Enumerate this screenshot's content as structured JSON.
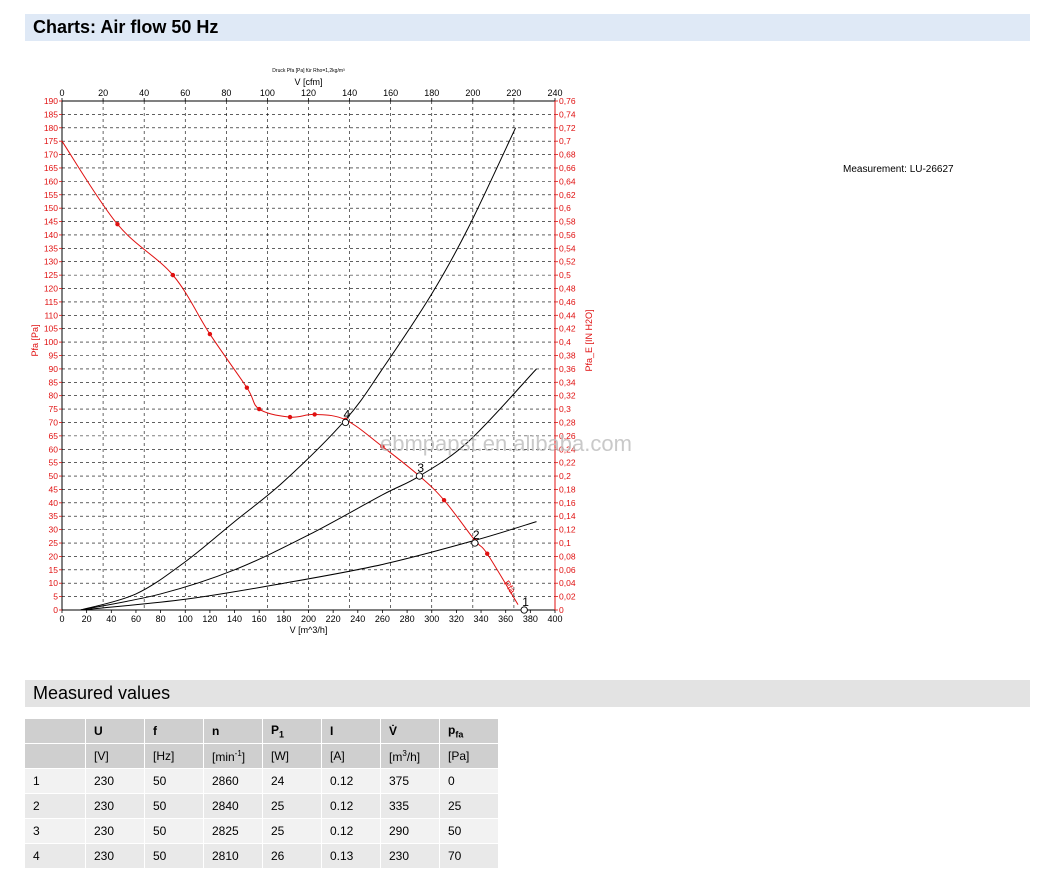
{
  "header": {
    "title": "Charts: Air flow 50 Hz"
  },
  "measurement_label": "Measurement: LU-26627",
  "watermark": "ebmpapst.en.alibaba.com",
  "chart_data": {
    "type": "line",
    "title": "Druck Pfa [Pa] für Rho=1,2kg/m³",
    "xlabel": "V [m^3/h]",
    "x2label": "V [cfm]",
    "ylabel": "Pfa [Pa]",
    "y2label": "Pfa_E [IN H2O]",
    "xlim": [
      0,
      400
    ],
    "ylim": [
      0,
      190
    ],
    "x2lim": [
      0,
      240
    ],
    "y2lim": [
      0,
      0.76
    ],
    "x_ticks": [
      "0",
      "20",
      "40",
      "60",
      "80",
      "100",
      "120",
      "140",
      "160",
      "180",
      "200",
      "220",
      "240",
      "260",
      "280",
      "300",
      "320",
      "340",
      "360",
      "380",
      "400"
    ],
    "x2_ticks": [
      "0",
      "20",
      "40",
      "60",
      "80",
      "100",
      "120",
      "140",
      "160",
      "180",
      "200",
      "220",
      "240"
    ],
    "y_ticks": [
      "0",
      "5",
      "10",
      "15",
      "20",
      "25",
      "30",
      "35",
      "40",
      "45",
      "50",
      "55",
      "60",
      "65",
      "70",
      "75",
      "80",
      "85",
      "90",
      "95",
      "100",
      "105",
      "110",
      "115",
      "120",
      "125",
      "130",
      "135",
      "140",
      "145",
      "150",
      "155",
      "160",
      "165",
      "170",
      "175",
      "180",
      "185",
      "190"
    ],
    "y2_ticks": [
      "0",
      "0,02",
      "0,04",
      "0,06",
      "0,08",
      "0,1",
      "0,12",
      "0,14",
      "0,16",
      "0,18",
      "0,2",
      "0,22",
      "0,24",
      "0,26",
      "0,28",
      "0,3",
      "0,32",
      "0,34",
      "0,36",
      "0,38",
      "0,4",
      "0,42",
      "0,44",
      "0,46",
      "0,48",
      "0,5",
      "0,52",
      "0,54",
      "0,56",
      "0,58",
      "0,6",
      "0,62",
      "0,64",
      "0,66",
      "0,68",
      "0,7",
      "0,72",
      "0,74",
      "0,76"
    ],
    "grid": true,
    "series": [
      {
        "name": "Pfa",
        "color": "#e01010",
        "x": [
          0,
          45,
          90,
          120,
          150,
          160,
          185,
          205,
          230,
          260,
          290,
          310,
          335,
          345,
          370
        ],
        "y": [
          175,
          144,
          125,
          103,
          83,
          75,
          72,
          73,
          71,
          61,
          50,
          41,
          26,
          21,
          2
        ]
      },
      {
        "name": "",
        "color": "#000000",
        "x": [
          15,
          60,
          100,
          140,
          180,
          230,
          260,
          300,
          330,
          368
        ],
        "y": [
          0,
          6,
          18,
          33,
          48,
          71,
          90,
          118,
          143,
          180
        ]
      },
      {
        "name": "",
        "color": "#000000",
        "x": [
          15,
          80,
          140,
          200,
          260,
          290,
          330,
          385
        ],
        "y": [
          0,
          6,
          15,
          28,
          43,
          50,
          63,
          90
        ]
      },
      {
        "name": "",
        "color": "#000000",
        "x": [
          15,
          100,
          180,
          260,
          335,
          385
        ],
        "y": [
          0,
          4,
          10,
          17,
          26,
          33
        ]
      }
    ],
    "points": [
      {
        "label": "1",
        "x": 375,
        "y": 0
      },
      {
        "label": "2",
        "x": 335,
        "y": 25
      },
      {
        "label": "3",
        "x": 290,
        "y": 50
      },
      {
        "label": "4",
        "x": 230,
        "y": 70
      }
    ],
    "curve_annotation": "Pfa"
  },
  "measured": {
    "title": "Measured values",
    "headers": [
      "",
      "U",
      "f",
      "n",
      "P1",
      "I",
      "V̇",
      "pfa"
    ],
    "units": [
      "",
      "[V]",
      "[Hz]",
      "[min-1]",
      "[W]",
      "[A]",
      "[m3/h]",
      "[Pa]"
    ],
    "rows": [
      [
        "1",
        "230",
        "50",
        "2860",
        "24",
        "0.12",
        "375",
        "0"
      ],
      [
        "2",
        "230",
        "50",
        "2840",
        "25",
        "0.12",
        "335",
        "25"
      ],
      [
        "3",
        "230",
        "50",
        "2825",
        "25",
        "0.12",
        "290",
        "50"
      ],
      [
        "4",
        "230",
        "50",
        "2810",
        "26",
        "0.13",
        "230",
        "70"
      ]
    ]
  }
}
